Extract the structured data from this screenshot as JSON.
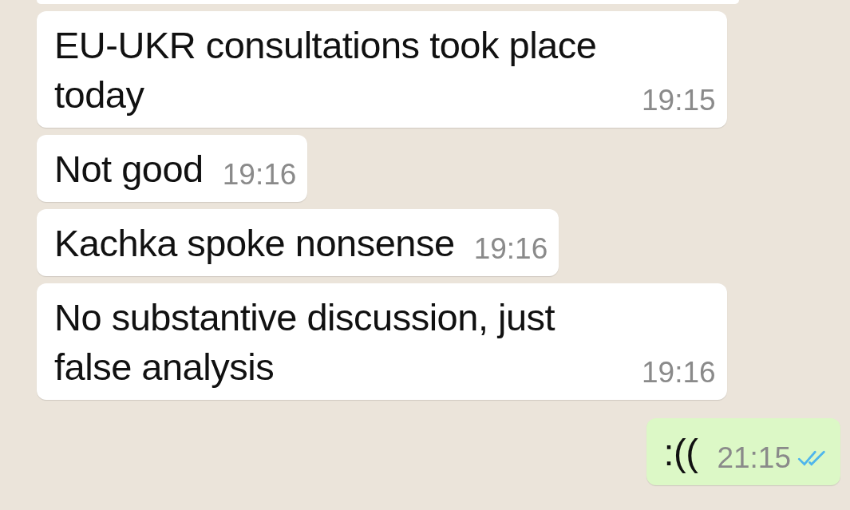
{
  "messages": [
    {
      "kind": "cut",
      "outgoing": false
    },
    {
      "kind": "text",
      "outgoing": false,
      "text": "EU-UKR consultations took place today",
      "time": "19:15"
    },
    {
      "kind": "text",
      "outgoing": false,
      "text": "Not good",
      "time": "19:16"
    },
    {
      "kind": "text",
      "outgoing": false,
      "text": "Kachka spoke nonsense",
      "time": "19:16"
    },
    {
      "kind": "text",
      "outgoing": false,
      "text": "No substantive discussion, just false analysis",
      "time": "19:16"
    },
    {
      "kind": "text",
      "outgoing": true,
      "text": ":((",
      "time": "21:15",
      "read": true
    }
  ]
}
